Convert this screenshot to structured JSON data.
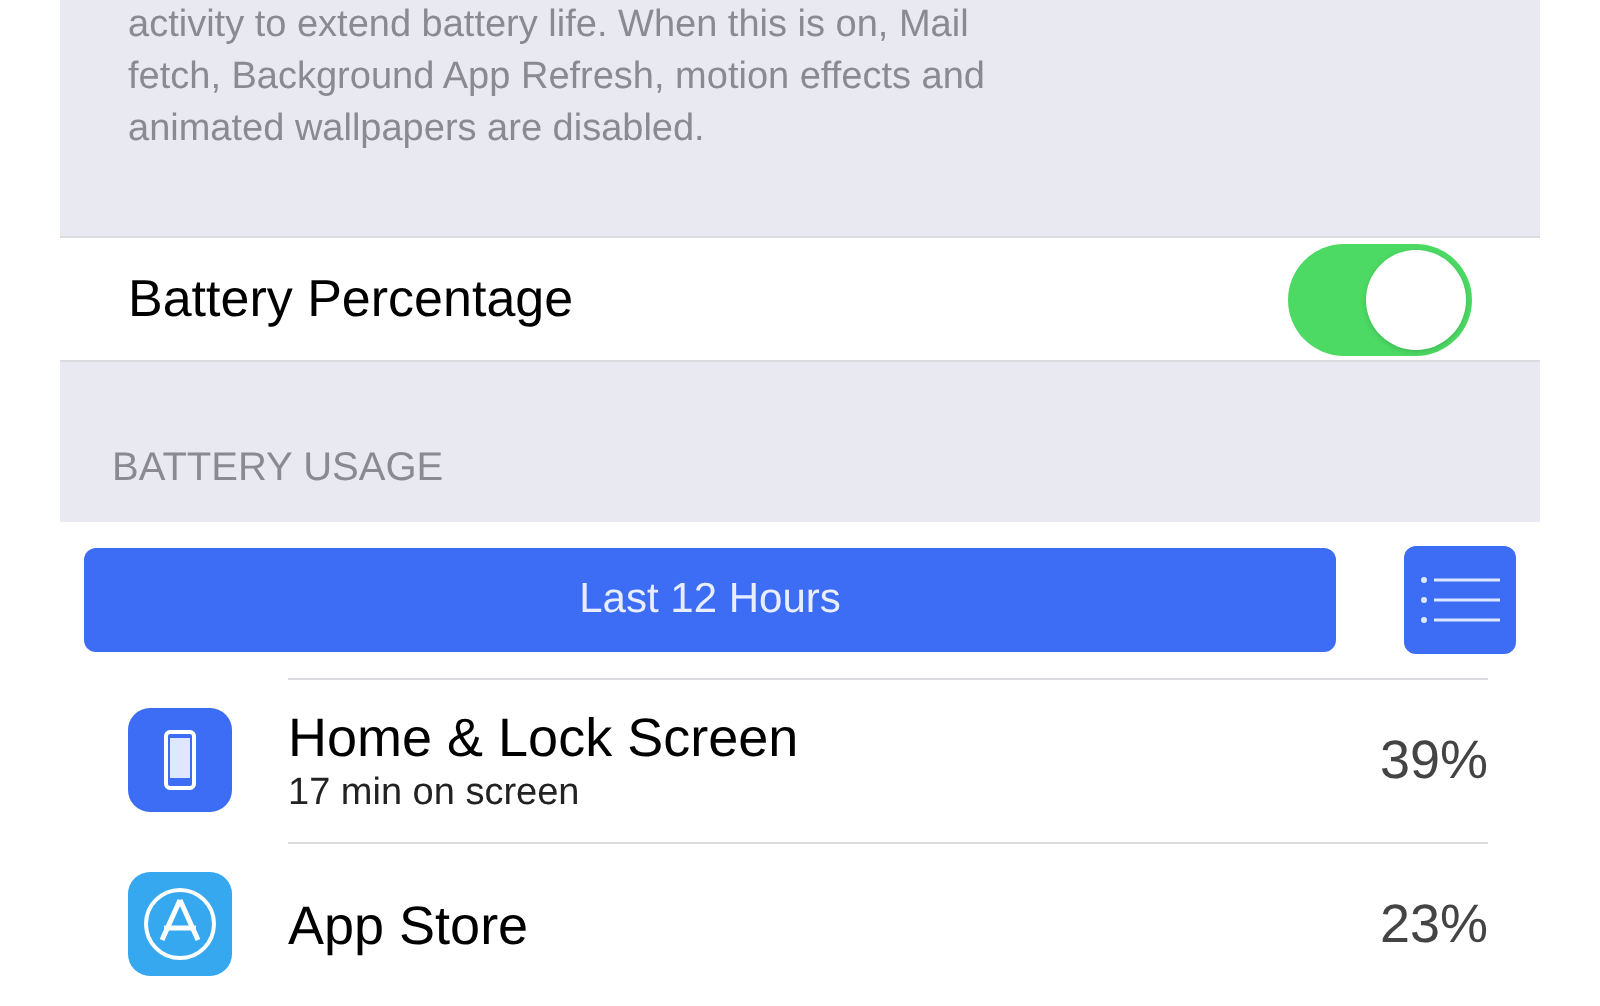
{
  "low_power_note": {
    "lines": [
      "activity to extend battery life. When this is on, Mail",
      "fetch, Background App Refresh, motion effects and",
      "animated wallpapers are disabled."
    ]
  },
  "battery_percentage": {
    "label": "Battery Percentage",
    "on": true
  },
  "battery_usage": {
    "header": "BATTERY USAGE",
    "period": {
      "label": "Last 12 Hours",
      "selected": true
    },
    "apps": [
      {
        "kind": "phone",
        "name": "Home & Lock Screen",
        "detail": "17 min on screen",
        "percent": "39%"
      },
      {
        "kind": "store",
        "name": "App Store",
        "percent": "23%"
      }
    ]
  }
}
